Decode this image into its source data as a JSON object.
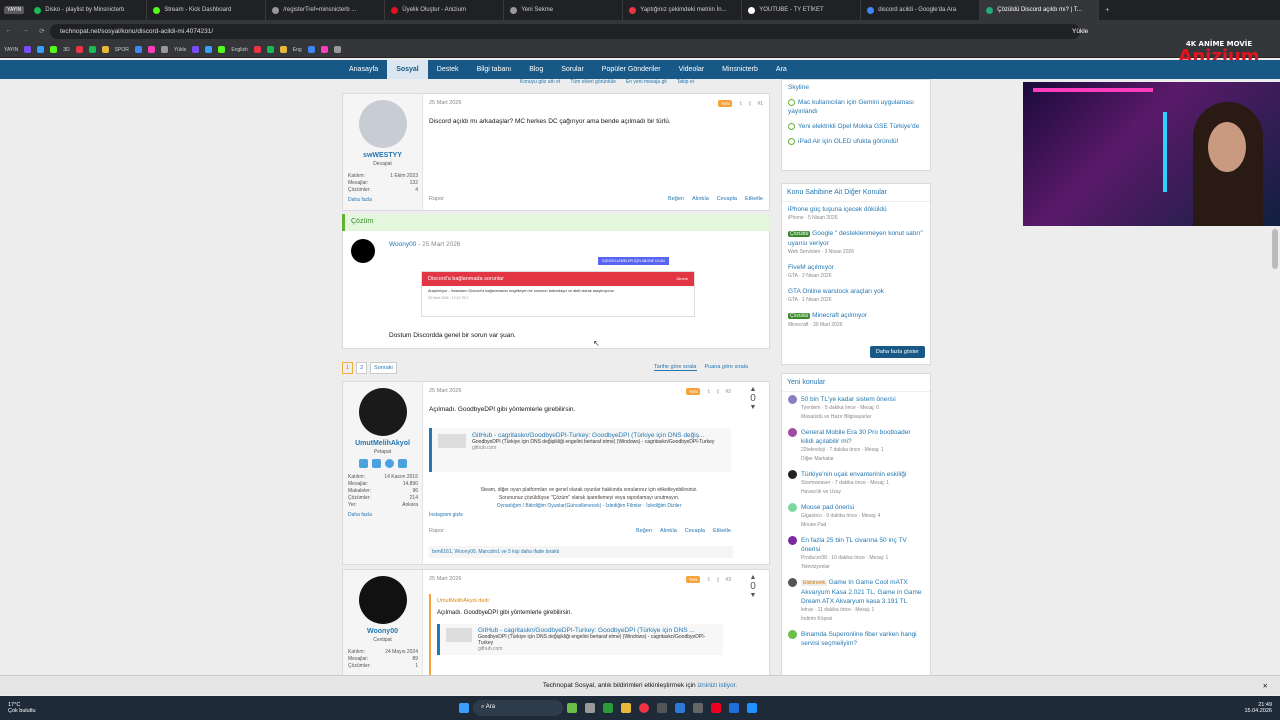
{
  "tabs": [
    {
      "label": "Disko - playlist by Minsnicterb",
      "color": "#1db954"
    },
    {
      "label": "Stream - Kick Dashboard",
      "color": "#53fc18"
    },
    {
      "label": "/registerTref=minsnicterb ...",
      "color": "#999"
    },
    {
      "label": "Üyelik Oluştur - Anizium",
      "color": "#e0141e"
    },
    {
      "label": "Yeni Sekme",
      "color": "#999"
    },
    {
      "label": "Yaptığınız çekimdeki metnin İn...",
      "color": "#e34"
    },
    {
      "label": "YOUTUBE - TY ETİKET",
      "color": "#fff"
    },
    {
      "label": "discord acildi - Google'da Ara",
      "color": "#4285f4"
    },
    {
      "label": "Çözüldü Discord açıldı mı? | T...",
      "color": "#2a7"
    }
  ],
  "yayin": "YAYIN",
  "url": "technopat.net/sosyal/konu/discord-acildi-mi.4074231/",
  "yukle": "Yükle",
  "bookmarks": [
    "YAYIN",
    "3D",
    "SPOR",
    "Yükle",
    "English",
    "Eng"
  ],
  "logo": {
    "top": "4K ANİME MOVİE",
    "name": "Anizium"
  },
  "sitenav": [
    "Anasayfa",
    "Sosyal",
    "Destek",
    "Bilgi tabanı",
    "Blog",
    "Sorular",
    "Popüler Gönderiler",
    "Videolar",
    "Minsnicterb",
    "Ara"
  ],
  "subnav": [
    "Konuyu göz attı et",
    "Tüm ekleri görüntüle",
    "En yeni mesaja git",
    "Takip et"
  ],
  "post1": {
    "date": "25 Mart 2026",
    "num": "#1",
    "badge": "Yeni",
    "user": "swWESTYY",
    "title": "Decapat",
    "stats": [
      [
        "Katılım:",
        "1 Ekim 2023"
      ],
      [
        "Mesajlar:",
        "132"
      ],
      [
        "Çözümler:",
        "4"
      ]
    ],
    "more": "Daha fazla",
    "text": "Discord açıldı mı arkadaşlar? MC herkes DC çağırıyor ama bende açılmadı bir türlü.",
    "report": "Rapor",
    "actions": [
      "Beğen",
      "Alıntıla",
      "Cevapla",
      "Etiketle"
    ]
  },
  "solution": {
    "label": "Çözüm",
    "user": "Woony00",
    "date": "25 Mart 2026",
    "banner": "GÜNCELLEMELER İÇİN ABONE OLUN",
    "err_title": "Discord'a bağlanmada sorunlar",
    "err_right": "Abone",
    "err_text": "Araştırılıyor - İnsanların Discord'a bağlanmasını engelleyen bir sorunun farkındayız ve aktif olarak araştırıyoruz.",
    "err_date": "25 Mart 2026 - 12:21 TDT",
    "text": "Dostum Discordda genel bir sorun var şuan."
  },
  "pager": {
    "p1": "1",
    "p2": "2",
    "next": "Sonraki",
    "sort1": "Tarihe göre sırala",
    "sort2": "Puana göre sırala"
  },
  "post2": {
    "date": "25 Mart 2026",
    "num": "#2",
    "badge": "Yeni",
    "vote": "0",
    "user": "UmutMelihAkyol",
    "title": "Petapat",
    "stats": [
      [
        "Katılım:",
        "14 Kasım 2015"
      ],
      [
        "Mesajlar:",
        "14,890"
      ],
      [
        "Makaleler:",
        "96"
      ],
      [
        "Çözümler:",
        "214"
      ],
      [
        "Yer:",
        "Ankara"
      ]
    ],
    "more": "Daha fazla",
    "text": "Açılmadı. GoodbyeDPI gibi yöntemlerle girebilirsin.",
    "gh_title": "GitHub - cagritaskn/GoodbyeDPI-Turkey: GoodbyeDPI (Türkiye için DNS değiş...",
    "gh_desc": "GoodbyeDPI (Türkiye için DNS değişikliği engelini bertaraf etme) (Windows) - cagritaskn/GoodbyeDPI-Turkey",
    "gh_site": "github.com",
    "sig1": "Steam, diğer oyun platformları ve genel olarak oyunlar hakkında sorularınız için etiketleyebilirsiniz.",
    "sig2": "Sorununuz çözüldüyse \"Çözüm\" olarak işaretlemeyi veya raporlamayı unutmayın.",
    "sig3": "Oynadığım / Bitirdiğim Oyunlar(Güncellenecek) · İzlediğim Filmler · İzlediğim Diziler",
    "sig4": "İnstagram gizle",
    "report": "Rapor",
    "actions": [
      "Beğen",
      "Alıntıla",
      "Cevapla",
      "Etiketle"
    ],
    "reactions": "brm6161, Woony00, Marcolin1 ve 5 kişi daha ifade bıraktı"
  },
  "post3": {
    "date": "25 Mart 2026",
    "num": "#3",
    "badge": "Yeni",
    "vote": "0",
    "user": "Woony00",
    "title": "Centipat",
    "stats": [
      [
        "Katılım:",
        "24 Mayıs 2024"
      ],
      [
        "Mesajlar:",
        "89"
      ],
      [
        "Çözümler:",
        "1"
      ]
    ],
    "quote_by": "UmutMelihAkyol dedi:",
    "quote": "Açılmadı. GoodbyeDPI gibi yöntemlerle girebilirsin.",
    "gh_title": "GitHub - cagritaskn/GoodbyeDPI-Turkey: GoodbyeDPI (Türkiye için DNS ...",
    "gh_desc": "GoodbyeDPI (Türkiye için DNS değişikliği engelini bertaraf etme) (Windows) - cagritaskn/GoodbyeDPI-Turkey",
    "gh_site": "github.com"
  },
  "sidebar_top": [
    {
      "text": "Skyline"
    },
    {
      "text": "Mac kullanıcıları için Gemini uygulaması yayınlandı"
    },
    {
      "text": "Yeni elektrikli Opel Mokka GSE Türkiye'de"
    },
    {
      "text": "iPad Air için OLED ufukta göründü!"
    }
  ],
  "related": {
    "title": "Konu Sahibine Ait Diğer Konular",
    "items": [
      {
        "text": "iPhone güç tuşuna içecek döküldü",
        "meta": "iPhone · 5 Nisan 2026",
        "badge": ""
      },
      {
        "text": "Google \" desteklenmeyen konut satırı\" uyarısı veriyor",
        "meta": "Web Servisleri · 3 Nisan 2026",
        "badge": "Çözüldü"
      },
      {
        "text": "FiveM açılmıyor",
        "meta": "GTA · 2 Nisan 2026",
        "badge": ""
      },
      {
        "text": "GTA Online warstock araçları yok",
        "meta": "GTA · 1 Nisan 2026",
        "badge": ""
      },
      {
        "text": "Minecraft açılmıyor",
        "meta": "Minecraft · 30 Mart 2026",
        "badge": "Çözüldü"
      }
    ],
    "more": "Daha fazla göster"
  },
  "newtopics": {
    "title": "Yeni konular",
    "items": [
      {
        "text": "50 bin TL'ye kadar sistem önerisi",
        "meta": "Tyerdem · 5 dakika önce · Mesaj: 0",
        "cat": "Masaüstü ve Hazır Bilgisayarlar",
        "color": "#8e7cc3",
        "badge": ""
      },
      {
        "text": "General Mobile Era 30 Pro bootloader kilidi açılabilir mi?",
        "meta": "22teknoloji · 7 dakika önce · Mesaj: 1",
        "cat": "Diğer Markalar",
        "color": "#a04aa0",
        "badge": ""
      },
      {
        "text": "Türkiye'nin uçak envanterinin eskiliği",
        "meta": "Stormweaver · 7 dakika önce · Mesaj: 1",
        "cat": "Havacılık ve Uzay",
        "color": "#222",
        "badge": ""
      },
      {
        "text": "Mouse pad önerisi",
        "meta": "Gigastico · 9 dakika önce · Mesaj: 4",
        "cat": "Mouse Pad",
        "color": "#7dd8a0",
        "badge": ""
      },
      {
        "text": "En fazla 25 bin TL civarına 50 inç TV önerisi",
        "meta": "Producer38 · 10 dakika önce · Mesaj: 1",
        "cat": "Televizyonlar",
        "color": "#7a2aa0",
        "badge": ""
      },
      {
        "text": "Game In Game Cool mATX Akvaryum Kasa 2.021 TL, Game in Game Dream ATX Akvaryum kasa 3.191 TL",
        "meta": "letrax · 11 dakika önce · Mesaj: 1",
        "cat": "İndirim Köşesi",
        "color": "#555",
        "badge": "Elektronik"
      },
      {
        "text": "Binamda Superonline fiber varken hangi servisi seçmeliyim?",
        "meta": "",
        "cat": "",
        "color": "#6cc04a",
        "badge": ""
      }
    ]
  },
  "banner": {
    "text": "Technopat Sosyal, anlık bildirimleri etkinleştirmek için",
    "link": "izninizi istiyor."
  },
  "taskbar": {
    "weather": "17°C",
    "weather_desc": "Çok bulutlu",
    "search": "Ara",
    "time": "21:49",
    "date": "15.04.2026"
  }
}
